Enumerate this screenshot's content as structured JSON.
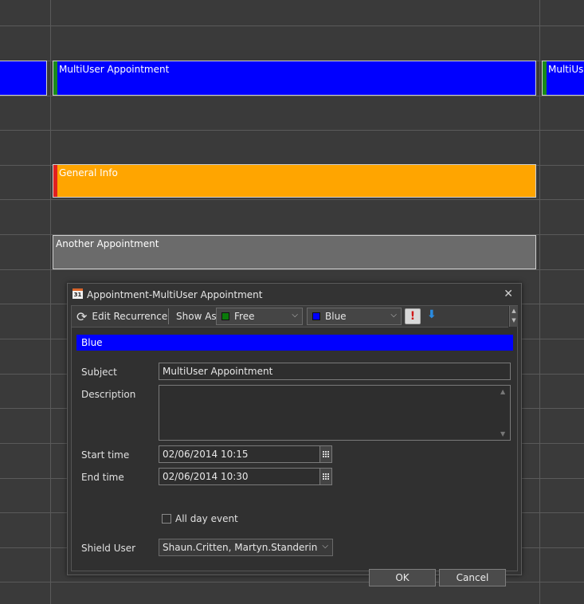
{
  "scheduler": {
    "appointments": [
      {
        "title": "",
        "color": "#0000ff",
        "bar": "#0000ff"
      },
      {
        "title": "MultiUser Appointment",
        "color": "#0000ff",
        "bar": "#1a8a1a"
      },
      {
        "title": "MultiUse",
        "color": "#0000ff",
        "bar": "#1a8a1a"
      },
      {
        "title": "General Info",
        "color": "#ffa500",
        "bar": "#e02020"
      },
      {
        "title": "Another Appointment",
        "color": "#6b6b6b",
        "bar": "#6b6b6b"
      }
    ]
  },
  "dialog": {
    "title": "Appointment-MultiUser Appointment",
    "toolbar": {
      "edit_recurrence": "Edit Recurrence",
      "show_as_label": "Show As",
      "show_as_value": "Free",
      "show_as_color": "#0a7a0a",
      "category_value": "Blue",
      "category_color": "#0000ff",
      "importance_glyph": "!",
      "low_importance_glyph": "⬇"
    },
    "color_banner": "Blue",
    "fields": {
      "subject_label": "Subject",
      "subject_value": "MultiUser Appointment",
      "description_label": "Description",
      "description_value": "",
      "start_label": "Start time",
      "start_value": "02/06/2014 10:15",
      "end_label": "End time",
      "end_value": "02/06/2014 10:30",
      "all_day_label": "All day event",
      "all_day_checked": false,
      "shield_label": "Shield User",
      "shield_value": "Shaun.Critten, Martyn.Standering, M"
    },
    "buttons": {
      "ok": "OK",
      "cancel": "Cancel"
    }
  }
}
